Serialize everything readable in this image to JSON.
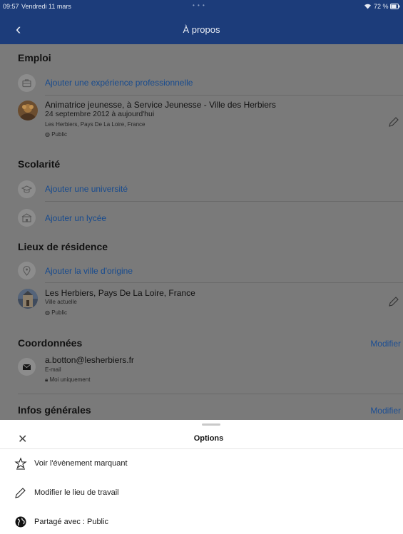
{
  "status_bar": {
    "time": "09:57",
    "date": "Vendredi 11 mars",
    "battery": "72 %"
  },
  "nav": {
    "title": "À propos",
    "back_icon": "chevron-left-icon"
  },
  "emploi": {
    "title": "Emploi",
    "add_label": "Ajouter une expérience professionnelle",
    "job": {
      "title": "Animatrice jeunesse, à Service Jeunesse - Ville des Herbiers",
      "dates": "24 septembre 2012 à aujourd'hui",
      "location": "Les Herbiers, Pays De La Loire, France",
      "privacy": "Public"
    }
  },
  "scolarite": {
    "title": "Scolarité",
    "add_university": "Ajouter une université",
    "add_lycee": "Ajouter un lycée"
  },
  "residence": {
    "title": "Lieux de résidence",
    "add_origin": "Ajouter la ville d'origine",
    "city": "Les Herbiers, Pays De La Loire, France",
    "city_type": "Ville actuelle",
    "privacy": "Public"
  },
  "coordonnees": {
    "title": "Coordonnées",
    "modify": "Modifier",
    "email": "a.botton@lesherbiers.fr",
    "email_type": "E-mail",
    "privacy": "Moi uniquement"
  },
  "infos": {
    "title": "Infos générales",
    "modify": "Modifier"
  },
  "sheet": {
    "title": "Options",
    "close": "✕",
    "options": [
      {
        "label": "Voir l'évènement marquant",
        "icon": "milestone-icon"
      },
      {
        "label": "Modifier le lieu de travail",
        "icon": "pencil-icon"
      },
      {
        "label": "Partagé avec : Public",
        "icon": "globe-icon"
      }
    ]
  },
  "colors": {
    "nav": "#1c3c7a",
    "overlay": "#7a7a7a",
    "link": "#184b8e"
  }
}
